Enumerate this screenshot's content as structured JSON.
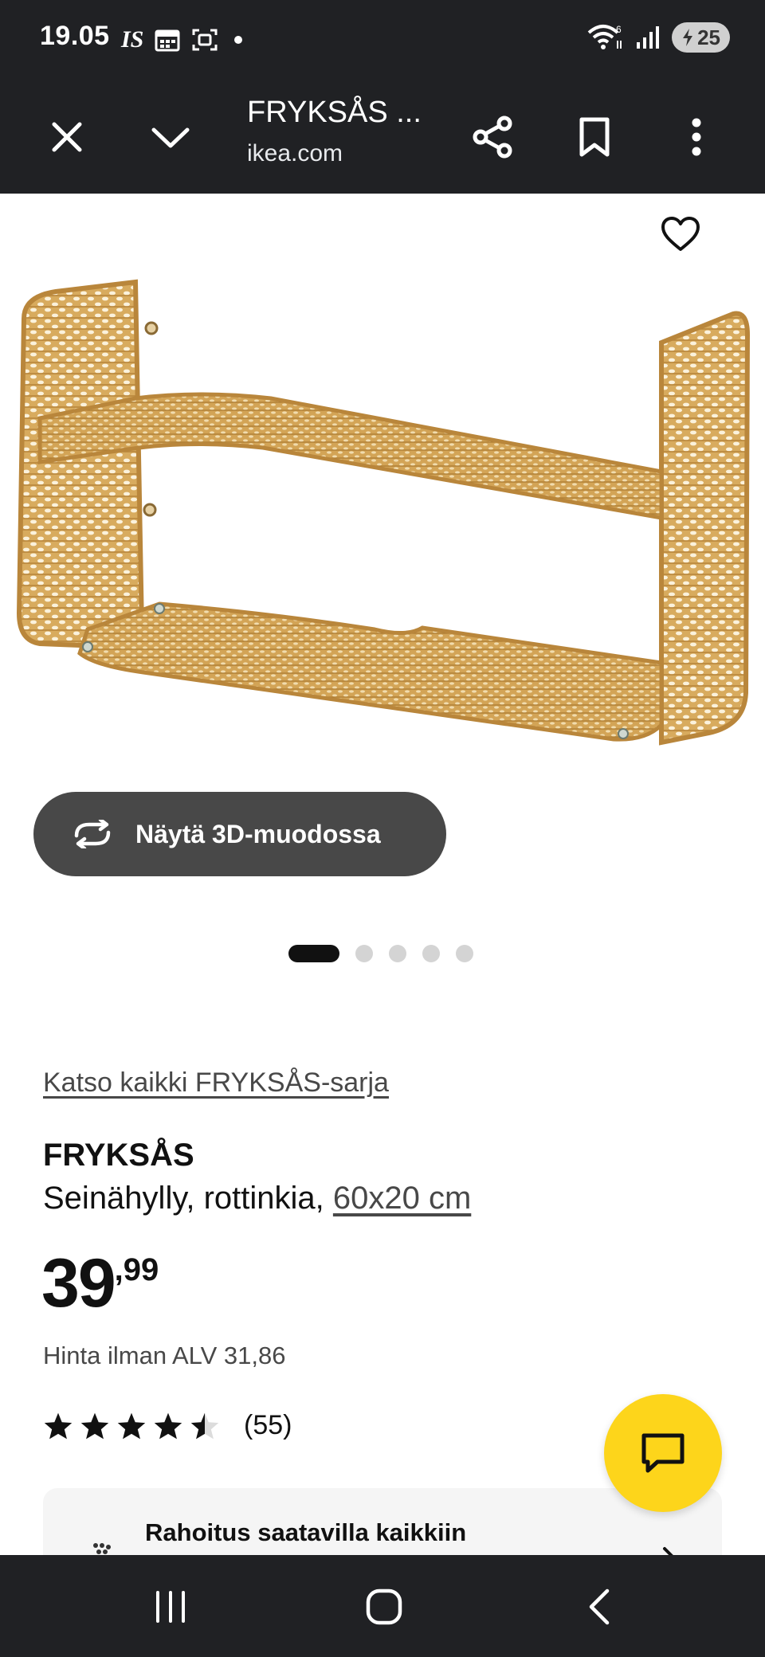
{
  "status_bar": {
    "time": "19.05",
    "left_icons": [
      "is-news-icon",
      "calendar-icon",
      "screenshot-icon",
      "notification-dot"
    ],
    "network_label": "6",
    "battery": "25"
  },
  "browser": {
    "tab_title": "FRYKSÅS ...",
    "domain": "ikea.com",
    "icons": [
      "close-icon",
      "chevron-down-icon",
      "share-icon",
      "bookmark-icon",
      "more-vert-icon"
    ]
  },
  "gallery": {
    "view_3d_label": "Näytä 3D-muodossa",
    "dot_count": 5,
    "active_dot": 0
  },
  "product": {
    "series_link": "Katso kaikki FRYKSÅS-sarja",
    "name": "FRYKSÅS",
    "description": "Seinähylly, rottinkia, ",
    "size": "60x20 cm",
    "price_integer": "39",
    "price_decimal": ",99",
    "price_vat": "Hinta ilman ALV 31,86",
    "rating": 4.5,
    "rating_max": 5,
    "review_count": "(55)"
  },
  "finance": {
    "title": "Rahoitus saatavilla kaikkiin"
  },
  "colors": {
    "dark_bar": "#202124",
    "fab_yellow": "#fdd51b",
    "button_dark": "#484848",
    "rattan": "#d6a85a"
  }
}
